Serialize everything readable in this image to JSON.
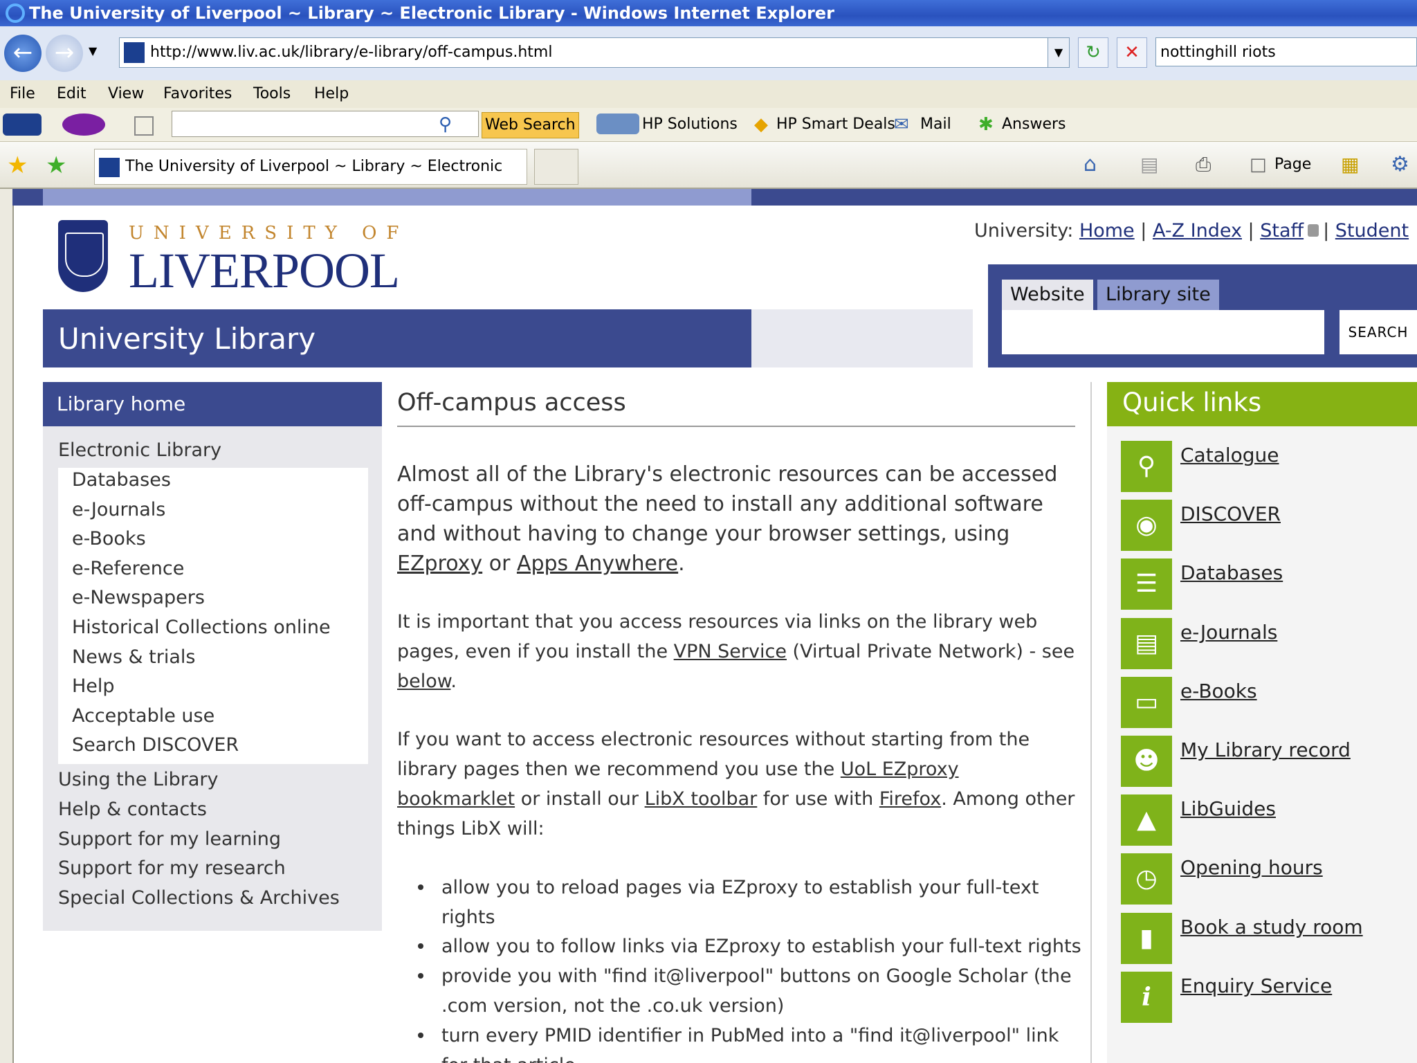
{
  "window": {
    "title": "The University of Liverpool ~ Library ~ Electronic Library - Windows Internet Explorer"
  },
  "address_bar": {
    "url": "http://www.liv.ac.uk/library/e-library/off-campus.html"
  },
  "search_box": {
    "value": "nottinghill riots"
  },
  "menu": [
    "File",
    "Edit",
    "View",
    "Favorites",
    "Tools",
    "Help"
  ],
  "links_toolbar": {
    "web_search": "Web Search",
    "hp_solutions": "HP Solutions",
    "hp_smart_deals": "HP Smart Deals",
    "mail": "Mail",
    "answers": "Answers"
  },
  "tab": {
    "title": "The University of Liverpool ~ Library ~ Electronic Library",
    "page_label": "Page"
  },
  "logo": {
    "top_line": "UNIVERSITY OF",
    "main_line": "LIVERPOOL"
  },
  "university_links": {
    "prefix": "University:",
    "items": [
      "Home",
      "A-Z Index",
      "Staff",
      "Student"
    ]
  },
  "banner": {
    "title": "University Library"
  },
  "site_search": {
    "tabs": [
      "Website",
      "Library site"
    ],
    "button": "SEARCH"
  },
  "sidebar": {
    "head": "Library home",
    "section": "Electronic Library",
    "sub_items": [
      "Databases",
      "e-Journals",
      "e-Books",
      "e-Reference",
      "e-Newspapers",
      "Historical Collections online",
      "News & trials",
      "Help",
      "Acceptable use",
      "Search DISCOVER"
    ],
    "items": [
      "Using the Library",
      "Help & contacts",
      "Support for my learning",
      "Support for my research",
      "Special Collections & Archives"
    ]
  },
  "content": {
    "heading": "Off-campus access",
    "p1": {
      "a": "Almost all of the Library's electronic resources can be accessed off-campus without the need to install any additional software and without having to change your browser settings, using ",
      "link1": "EZproxy",
      "b": " or ",
      "link2": "Apps Anywhere",
      "c": "."
    },
    "p2": {
      "a": "It is important that you access resources via links on the library web pages, even if you install the ",
      "link1": "VPN Service",
      "b": " (Virtual Private Network) - see ",
      "link2": "below",
      "c": "."
    },
    "p3": {
      "a": "If you want to access electronic resources without starting from the library pages then we recommend you use the ",
      "link1": "UoL EZproxy bookmarklet",
      "b": " or install our ",
      "link2": "LibX toolbar",
      "c": " for use with ",
      "link3": "Firefox",
      "d": ". Among other things LibX will:"
    },
    "bullets": [
      "allow you to reload pages via EZproxy to establish your full-text rights",
      "allow you to follow links via EZproxy to establish your full-text rights",
      "provide you with \"find it@liverpool\" buttons on Google Scholar (the .com version, not the .co.uk version)",
      "turn every PMID identifier in PubMed into a \"find it@liverpool\" link for that article"
    ]
  },
  "quick_links": {
    "title": "Quick links",
    "items": [
      "Catalogue",
      "DISCOVER",
      "Databases",
      "e-Journals",
      "e-Books",
      "My Library record",
      "LibGuides",
      "Opening hours",
      "Book a study room",
      "Enquiry Service"
    ]
  },
  "colors": {
    "brand_navy": "#3b4a8f",
    "quick_links_green": "#86b214",
    "logo_gold": "#c2852d"
  }
}
